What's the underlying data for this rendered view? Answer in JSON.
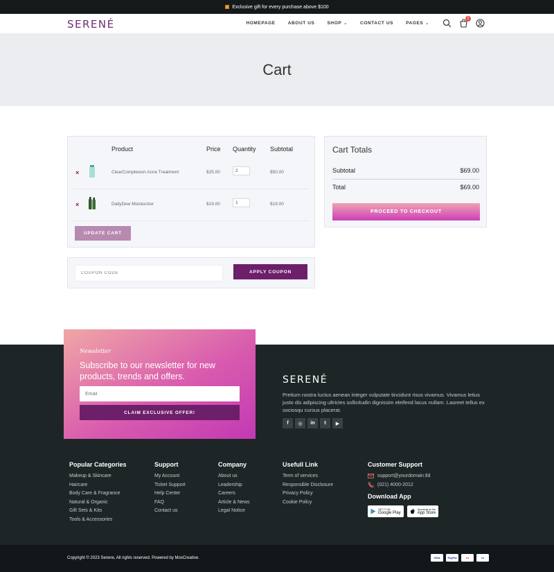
{
  "topbar": {
    "text": "Exclusive gift for every purchase above $100"
  },
  "header": {
    "logo": "SERENÉ",
    "nav": [
      {
        "label": "HOMEPAGE",
        "dropdown": false
      },
      {
        "label": "ABOUT US",
        "dropdown": false
      },
      {
        "label": "SHOP",
        "dropdown": true
      },
      {
        "label": "CONTACT US",
        "dropdown": false
      },
      {
        "label": "PAGES",
        "dropdown": true
      }
    ],
    "cart_count": "2"
  },
  "hero": {
    "title": "Cart"
  },
  "cart": {
    "headers": {
      "product": "Product",
      "price": "Price",
      "quantity": "Quantity",
      "subtotal": "Subtotal"
    },
    "remove_symbol": "×",
    "items": [
      {
        "name": "ClearComplexion Acne Treatment",
        "price": "$25.00",
        "quantity": "2",
        "subtotal": "$50.00"
      },
      {
        "name": "DailyDew Moisturizer",
        "price": "$19.00",
        "quantity": "1",
        "subtotal": "$19.00"
      }
    ],
    "update_label": "UPDATE CART"
  },
  "coupon": {
    "placeholder": "COUPON CODE",
    "button_label": "APPLY COUPON"
  },
  "totals": {
    "title": "Cart Totals",
    "subtotal_label": "Subtotal",
    "subtotal_value": "$69.00",
    "total_label": "Total",
    "total_value": "$69.00",
    "checkout_label": "PROCEED TO CHECKOUT"
  },
  "newsletter": {
    "label": "Newsletter",
    "title": "Subscribe to our newsletter for new products, trends and offers.",
    "placeholder": "Email",
    "button_label": "CLAIM EXCLUSIVE OFFER!"
  },
  "footer": {
    "logo": "SERENÉ",
    "description": "Pretium nostra luctus aenean integer vulputate tincidunt risus vivamus. Vivamus letius justo dis adipiscing ultricies sollicitudin dignissim eleifend lacus nullam. Laoreet tellus ex sociosqu cursus placerat.",
    "socials": [
      "f",
      "◎",
      "in",
      "t",
      "▶"
    ],
    "columns": [
      {
        "title": "Popular Categories",
        "links": [
          "Makeup & Skincare",
          "Haircare",
          "Body Care & Fragrance",
          "Natural & Organic",
          "Gift Sets & Kits",
          "Tools & Accessories"
        ]
      },
      {
        "title": "Support",
        "links": [
          "My Account",
          "Ticket Support",
          "Help Center",
          "FAQ",
          "Contact us"
        ]
      },
      {
        "title": "Company",
        "links": [
          "About us",
          "Leadership",
          "Careers",
          "Article & News",
          "Legal Notice"
        ]
      },
      {
        "title": "Usefull Link",
        "links": [
          "Term of services",
          "Responsible Disclosure",
          "Privacy Policy",
          "Cookie Policy"
        ]
      }
    ],
    "customer_support": {
      "title": "Customer Support",
      "email": "support@yourdomain.tld",
      "phone": "(021) 4000-2012",
      "download_title": "Download App",
      "google_small": "GET IT ON",
      "google_label": "Google Play",
      "apple_small": "Download on the",
      "apple_label": "App Store"
    }
  },
  "bottom": {
    "copyright": "Copyright © 2023 Serene, All rights reserved. Powered by MoxCreative.",
    "payments": [
      "VISA",
      "PayPal",
      "●●",
      "●●"
    ]
  },
  "colors": {
    "brand": "#6f2b77",
    "accent_dark": "#6d1f6a",
    "footer_bg": "#1e2526"
  }
}
